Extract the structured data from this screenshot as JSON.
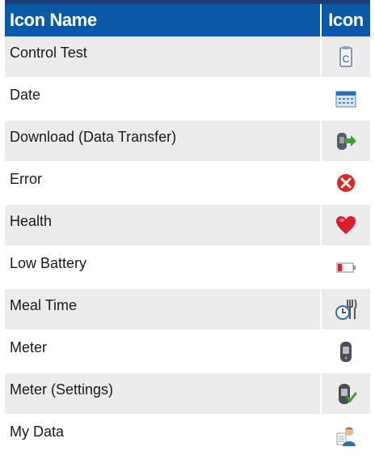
{
  "header": {
    "name_label": "Icon Name",
    "icon_label": "Icon"
  },
  "rows": [
    {
      "name": "Control Test",
      "icon": "control-test-icon"
    },
    {
      "name": "Date",
      "icon": "calendar-icon"
    },
    {
      "name": "Download (Data Transfer)",
      "icon": "download-icon"
    },
    {
      "name": "Error",
      "icon": "error-icon"
    },
    {
      "name": "Health",
      "icon": "heart-icon"
    },
    {
      "name": "Low Battery",
      "icon": "low-battery-icon"
    },
    {
      "name": "Meal Time",
      "icon": "meal-time-icon"
    },
    {
      "name": "Meter",
      "icon": "meter-icon"
    },
    {
      "name": "Meter (Settings)",
      "icon": "meter-settings-icon"
    },
    {
      "name": "My Data",
      "icon": "my-data-icon"
    }
  ],
  "colors": {
    "header_bg": "#0a5aa8",
    "header_topline": "#1b3f78",
    "row_shaded": "#ececec",
    "row_plain": "#ffffff"
  }
}
